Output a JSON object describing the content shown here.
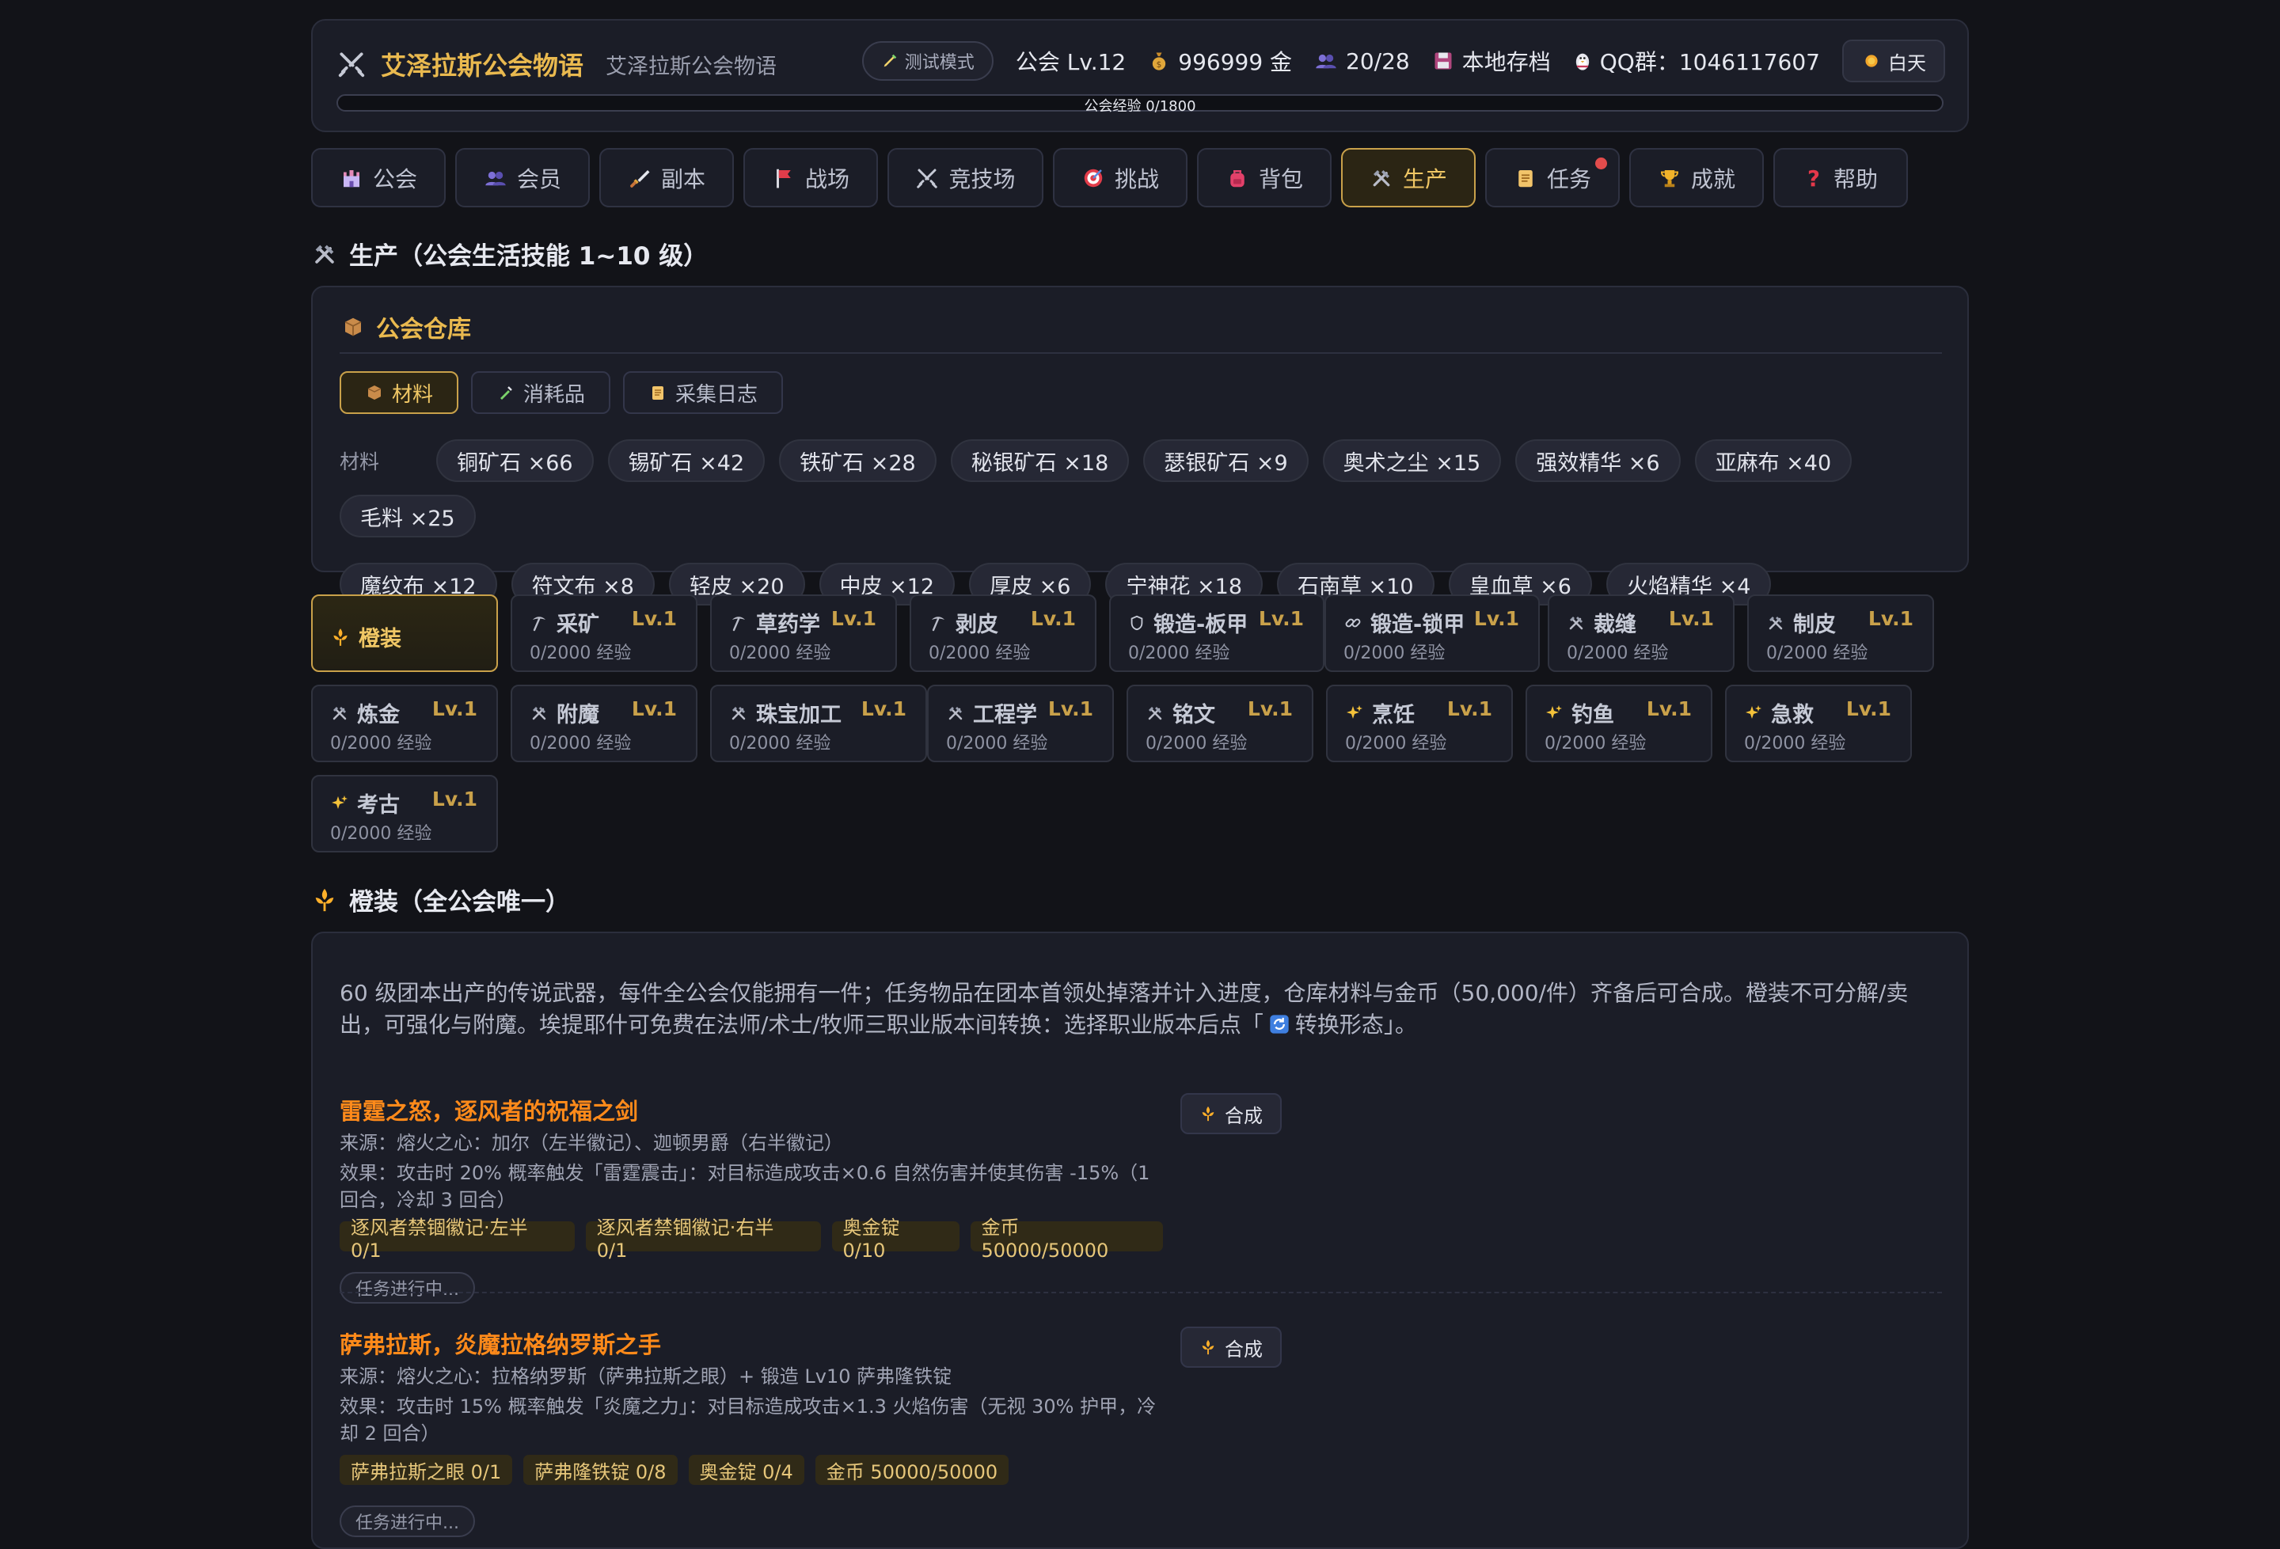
{
  "header": {
    "title": "艾泽拉斯公会物语",
    "subtitle": "艾泽拉斯公会物语",
    "test_mode": "测试模式",
    "guild_level": "公会 Lv.12",
    "gold": "996999 金",
    "members": "20/28",
    "save": "本地存档",
    "qq": "QQ群：1046117607",
    "day_mode": "白天",
    "xp_text": "公会经验 0/1800",
    "xp_fraction": 0
  },
  "nav": {
    "tabs": [
      {
        "label": "公会",
        "icon": "castle-icon"
      },
      {
        "label": "会员",
        "icon": "members-icon"
      },
      {
        "label": "副本",
        "icon": "dagger-icon"
      },
      {
        "label": "战场",
        "icon": "flag-icon"
      },
      {
        "label": "竞技场",
        "icon": "crossed-swords-icon"
      },
      {
        "label": "挑战",
        "icon": "target-icon"
      },
      {
        "label": "背包",
        "icon": "backpack-icon"
      },
      {
        "label": "生产",
        "icon": "hammer-pick-icon",
        "active": true
      },
      {
        "label": "任务",
        "icon": "scroll-icon",
        "badge": true
      },
      {
        "label": "成就",
        "icon": "trophy-icon"
      },
      {
        "label": "帮助",
        "icon": "question-icon"
      }
    ]
  },
  "production": {
    "title": "生产（公会生活技能 1~10 级）"
  },
  "warehouse": {
    "title": "公会仓库",
    "tabs": [
      "材料",
      "消耗品",
      "采集日志"
    ],
    "active_tab": "材料",
    "materials_label": "材料",
    "materials": [
      "铜矿石 ×66",
      "锡矿石 ×42",
      "铁矿石 ×28",
      "秘银矿石 ×18",
      "瑟银矿石 ×9",
      "奥术之尘 ×15",
      "强效精华 ×6",
      "亚麻布 ×40",
      "毛料 ×25",
      "魔纹布 ×12",
      "符文布 ×8",
      "轻皮 ×20",
      "中皮 ×12",
      "厚皮 ×6",
      "宁神花 ×18",
      "石南草 ×10",
      "皇血草 ×6",
      "火焰精华 ×4"
    ]
  },
  "skills": {
    "legendary_label": "橙装",
    "items": [
      {
        "name": "采矿",
        "level": "Lv.1",
        "xp": "0/2000 经验",
        "icon": "pickaxe-icon"
      },
      {
        "name": "草药学",
        "level": "Lv.1",
        "xp": "0/2000 经验",
        "icon": "pickaxe-icon"
      },
      {
        "name": "剥皮",
        "level": "Lv.1",
        "xp": "0/2000 经验",
        "icon": "pickaxe-icon"
      },
      {
        "name": "锻造-板甲",
        "level": "Lv.1",
        "xp": "0/2000 经验",
        "icon": "shield-icon"
      },
      {
        "name": "锻造-锁甲",
        "level": "Lv.1",
        "xp": "0/2000 经验",
        "icon": "chain-icon"
      },
      {
        "name": "裁缝",
        "level": "Lv.1",
        "xp": "0/2000 经验",
        "icon": "hammer-pick-icon"
      },
      {
        "name": "制皮",
        "level": "Lv.1",
        "xp": "0/2000 经验",
        "icon": "hammer-pick-icon"
      },
      {
        "name": "炼金",
        "level": "Lv.1",
        "xp": "0/2000 经验",
        "icon": "hammer-pick-icon"
      },
      {
        "name": "附魔",
        "level": "Lv.1",
        "xp": "0/2000 经验",
        "icon": "hammer-pick-icon"
      },
      {
        "name": "珠宝加工",
        "level": "Lv.1",
        "xp": "0/2000 经验",
        "icon": "hammer-pick-icon"
      },
      {
        "name": "工程学",
        "level": "Lv.1",
        "xp": "0/2000 经验",
        "icon": "hammer-pick-icon"
      },
      {
        "name": "铭文",
        "level": "Lv.1",
        "xp": "0/2000 经验",
        "icon": "hammer-pick-icon"
      },
      {
        "name": "烹饪",
        "level": "Lv.1",
        "xp": "0/2000 经验",
        "icon": "sparkle-icon"
      },
      {
        "name": "钓鱼",
        "level": "Lv.1",
        "xp": "0/2000 经验",
        "icon": "sparkle-icon"
      },
      {
        "name": "急救",
        "level": "Lv.1",
        "xp": "0/2000 经验",
        "icon": "sparkle-icon"
      },
      {
        "name": "考古",
        "level": "Lv.1",
        "xp": "0/2000 经验",
        "icon": "sparkle-icon"
      }
    ]
  },
  "legendary": {
    "title": "橙装（全公会唯一）",
    "desc_1": "60 级团本出产的传说武器，每件全公会仅能拥有一件；任务物品在团本首领处掉落并计入进度，仓库材料与金币（50,000/件）齐备后可合成。橙装不可分解/卖出，可强化与附魔。埃提耶什可免费在法师/术士/牧师三职业版本间转换：选择职业版本后点「",
    "desc_2": "转换形态」。",
    "craft_label": "合成",
    "in_progress": "任务进行中...",
    "items": [
      {
        "name": "雷霆之怒，逐风者的祝福之剑",
        "source": "来源：熔火之心：加尔（左半徽记）、迦顿男爵（右半徽记）",
        "effect": "效果：攻击时 20% 概率触发「雷霆震击」：对目标造成攻击×0.6 自然伤害并使其伤害 -15%（1 回合，冷却 3 回合）",
        "reqs": [
          "逐风者禁锢徽记·左半 0/1",
          "逐风者禁锢徽记·右半 0/1",
          "奥金锭 0/10",
          "金币 50000/50000"
        ]
      },
      {
        "name": "萨弗拉斯，炎魔拉格纳罗斯之手",
        "source": "来源：熔火之心：拉格纳罗斯（萨弗拉斯之眼）+ 锻造 Lv10 萨弗隆铁锭",
        "effect": "效果：攻击时 15% 概率触发「炎魔之力」：对目标造成攻击×1.3 火焰伤害（无视 30% 护甲，冷却 2 回合）",
        "reqs": [
          "萨弗拉斯之眼 0/1",
          "萨弗隆铁锭 0/8",
          "奥金锭 0/4",
          "金币 50000/50000"
        ]
      }
    ]
  }
}
